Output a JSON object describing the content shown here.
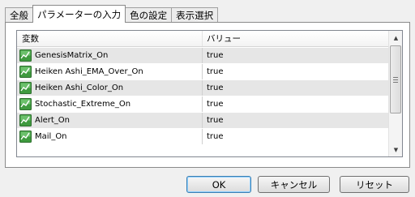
{
  "tabs": [
    {
      "label": "全般"
    },
    {
      "label": "パラメーターの入力"
    },
    {
      "label": "色の設定"
    },
    {
      "label": "表示選択"
    }
  ],
  "list": {
    "headers": {
      "name": "変数",
      "value": "バリュー"
    },
    "rows": [
      {
        "name": "GenesisMatrix_On",
        "value": "true",
        "icon": "parameter-icon"
      },
      {
        "name": "Heiken Ashi_EMA_Over_On",
        "value": "true",
        "icon": "parameter-icon"
      },
      {
        "name": "Heiken Ashi_Color_On",
        "value": "true",
        "icon": "parameter-icon"
      },
      {
        "name": "Stochastic_Extreme_On",
        "value": "true",
        "icon": "parameter-icon"
      },
      {
        "name": "Alert_On",
        "value": "true",
        "icon": "parameter-icon"
      },
      {
        "name": "Mail_On",
        "value": "true",
        "icon": "parameter-icon"
      }
    ]
  },
  "buttons": {
    "ok": "OK",
    "cancel": "キャンセル",
    "reset": "リセット"
  }
}
